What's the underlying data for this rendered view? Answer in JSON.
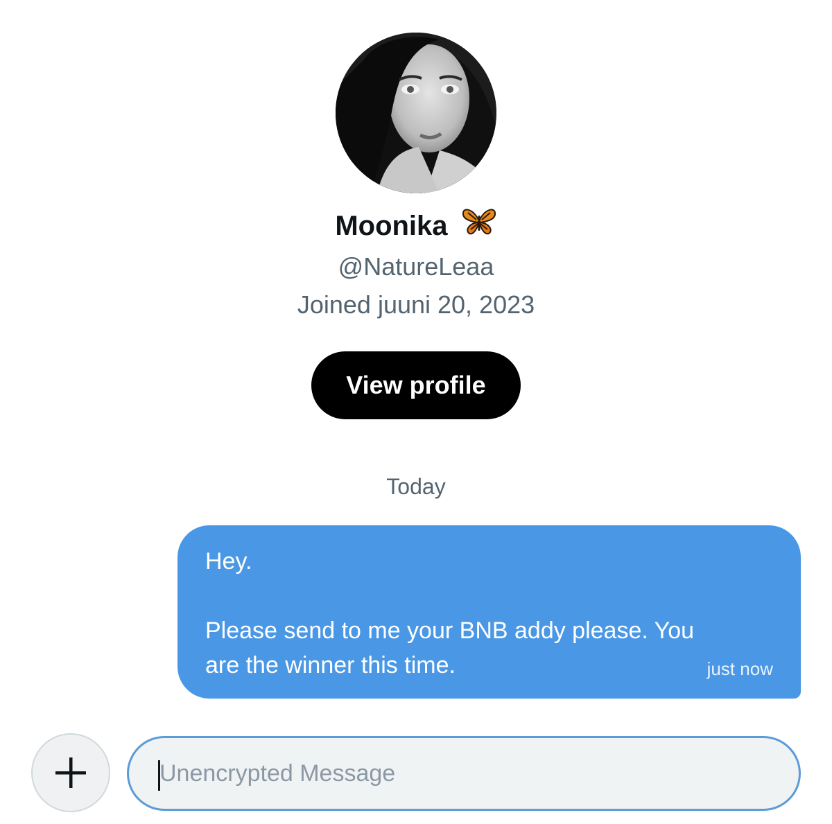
{
  "profile": {
    "display_name": "Moonika",
    "emoji_icon": "butterfly-icon",
    "handle": "@NatureLeaa",
    "joined": "Joined juuni 20, 2023",
    "view_profile_label": "View profile"
  },
  "conversation": {
    "date_separator": "Today",
    "messages": [
      {
        "lines": [
          "Hey.",
          "Please send to me your BNB addy please. You",
          "are the winner this time."
        ],
        "time": "just now",
        "color": "#4a98e5"
      }
    ]
  },
  "composer": {
    "add_icon": "plus-icon",
    "placeholder": "Unencrypted Message"
  }
}
